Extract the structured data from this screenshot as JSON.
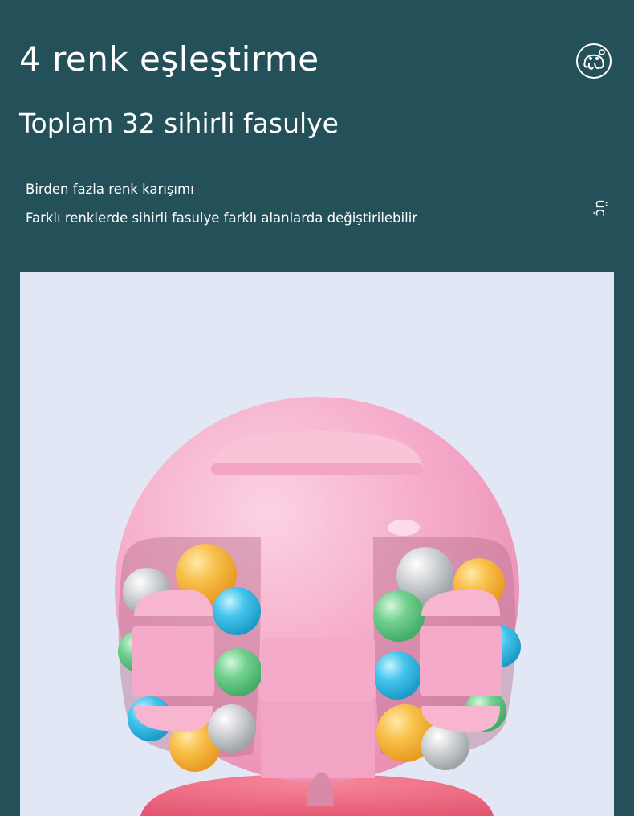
{
  "header": {
    "title": "4 renk eşleştirme",
    "subtitle": "Toplam 32 sihirli fasulye"
  },
  "features": [
    "Birden fazla renk karışımı",
    "Farklı renklerde sihirli fasulye farklı alanlarda değiştirilebilir"
  ],
  "side_label": "üç",
  "icons": {
    "brand": "octopus-logo-icon"
  },
  "colors": {
    "background": "#235059",
    "photo_background": "#e2e7f6",
    "toy_pink": "#f5a9c8",
    "base_coral": "#f06a80",
    "bead_yellow": "#f6b53a",
    "bead_blue": "#3fbde6",
    "bead_green": "#6fcf8a",
    "bead_gray": "#c9cccf"
  }
}
